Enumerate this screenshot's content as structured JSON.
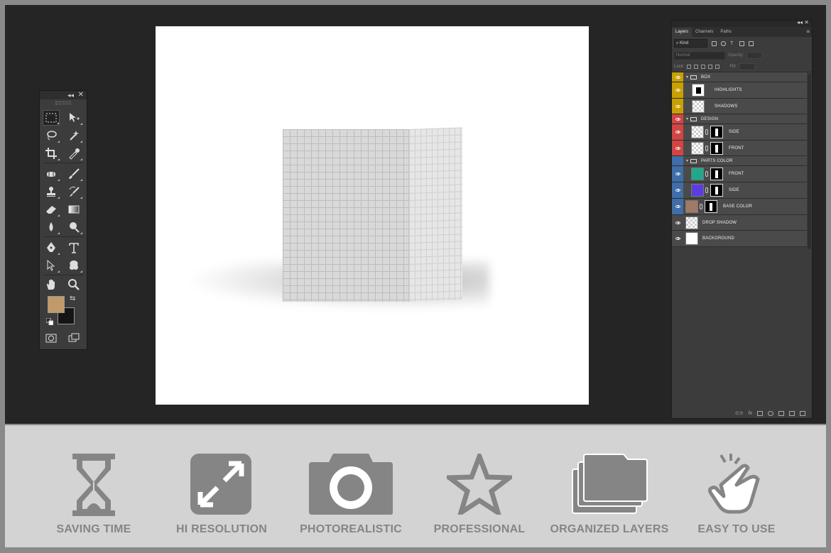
{
  "layers_panel": {
    "tabs": [
      "Layers",
      "Channels",
      "Paths"
    ],
    "kind": "Kind",
    "blend_mode": "Normal",
    "opacity_label": "Opacity:",
    "lock_label": "Lock:",
    "fill_label": "Fill:",
    "layers": [
      {
        "name": "BOX",
        "type": "group",
        "color": "#c8a000"
      },
      {
        "name": "HIGHLIGHTS",
        "type": "layer",
        "color": "#c8a000"
      },
      {
        "name": "SHADOWS",
        "type": "layer",
        "color": "#c8a000"
      },
      {
        "name": "DESIGN",
        "type": "group",
        "color": "#d24545"
      },
      {
        "name": "SIDE",
        "type": "smart",
        "color": "#d24545"
      },
      {
        "name": "FRONT",
        "type": "smart",
        "color": "#d24545"
      },
      {
        "name": "PARTS COLOR",
        "type": "group",
        "color": "#3f6ea8"
      },
      {
        "name": "FRONT",
        "type": "fill",
        "color": "#3f6ea8",
        "swatch": "#1fa98a"
      },
      {
        "name": "SIDE",
        "type": "fill",
        "color": "#3f6ea8",
        "swatch": "#5a3de0"
      },
      {
        "name": "BASE COLOR",
        "type": "fill",
        "color": "#3f6ea8",
        "swatch": "#a07a66"
      },
      {
        "name": "DROP SHADOW",
        "type": "layer",
        "color": "none"
      },
      {
        "name": "BACKGROUND",
        "type": "white",
        "color": "none"
      }
    ]
  },
  "toolbar": {
    "foreground_color": "#c19a6b",
    "background_color": "#151515",
    "tools": [
      "marquee-icon",
      "move-icon",
      "lasso-icon",
      "magic-wand-icon",
      "crop-icon",
      "eyedropper-icon",
      "spot-heal-icon",
      "brush-icon",
      "stamp-icon",
      "history-brush-icon",
      "eraser-icon",
      "gradient-icon",
      "blur-icon",
      "dodge-icon",
      "pen-icon",
      "type-icon",
      "path-select-icon",
      "shape-icon",
      "hand-icon",
      "zoom-icon",
      "quick-mask-icon",
      "screen-mode-icon"
    ]
  },
  "features": [
    {
      "label": "SAVING TIME",
      "icon": "hourglass-icon"
    },
    {
      "label": "HI RESOLUTION",
      "icon": "expand-icon"
    },
    {
      "label": "PHOTOREALISTIC",
      "icon": "camera-icon"
    },
    {
      "label": "PROFESSIONAL",
      "icon": "star-icon"
    },
    {
      "label": "ORGANIZED LAYERS",
      "icon": "folders-icon"
    },
    {
      "label": "EASY TO USE",
      "icon": "tap-hand-icon"
    }
  ],
  "colors": {
    "icon_gray": "#858585",
    "workspace": "#252525",
    "feature_bg": "#d3d3d3"
  }
}
